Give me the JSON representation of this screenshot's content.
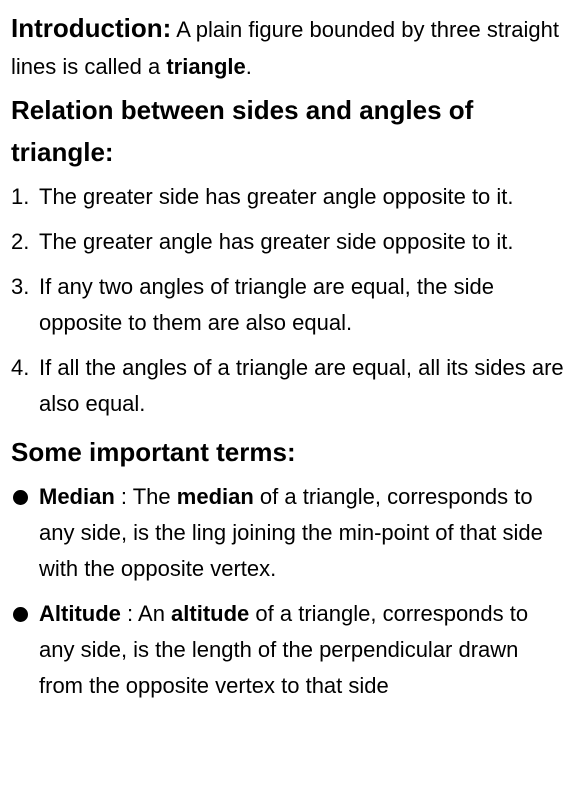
{
  "intro": {
    "label": "Introduction:",
    "text_before": " A plain figure bounded by three straight lines is called a ",
    "bold_term": "triangle",
    "text_after": "."
  },
  "relations": {
    "heading": "Relation between sides and angles of triangle:",
    "items": [
      {
        "num": "1.",
        "text": "The greater side has greater angle opposite to it."
      },
      {
        "num": "2.",
        "text": "The greater angle has greater side opposite to it."
      },
      {
        "num": "3.",
        "text": "If any two angles of triangle are equal, the side opposite to them are also equal."
      },
      {
        "num": "4.",
        "text": "If all the angles of a triangle are equal, all its sides are also equal."
      }
    ]
  },
  "terms": {
    "heading": "Some important terms:",
    "items": [
      {
        "term": "Median",
        "sep": " : The ",
        "term_inline": "median",
        "rest": " of a triangle, corresponds to any side, is the ling joining the min-point of that side with the opposite vertex."
      },
      {
        "term": "Altitude",
        "sep": " : An ",
        "term_inline": "altitude",
        "rest": " of a triangle, corresponds to any side, is the length of the perpendicular drawn from the opposite vertex to that side"
      }
    ]
  }
}
